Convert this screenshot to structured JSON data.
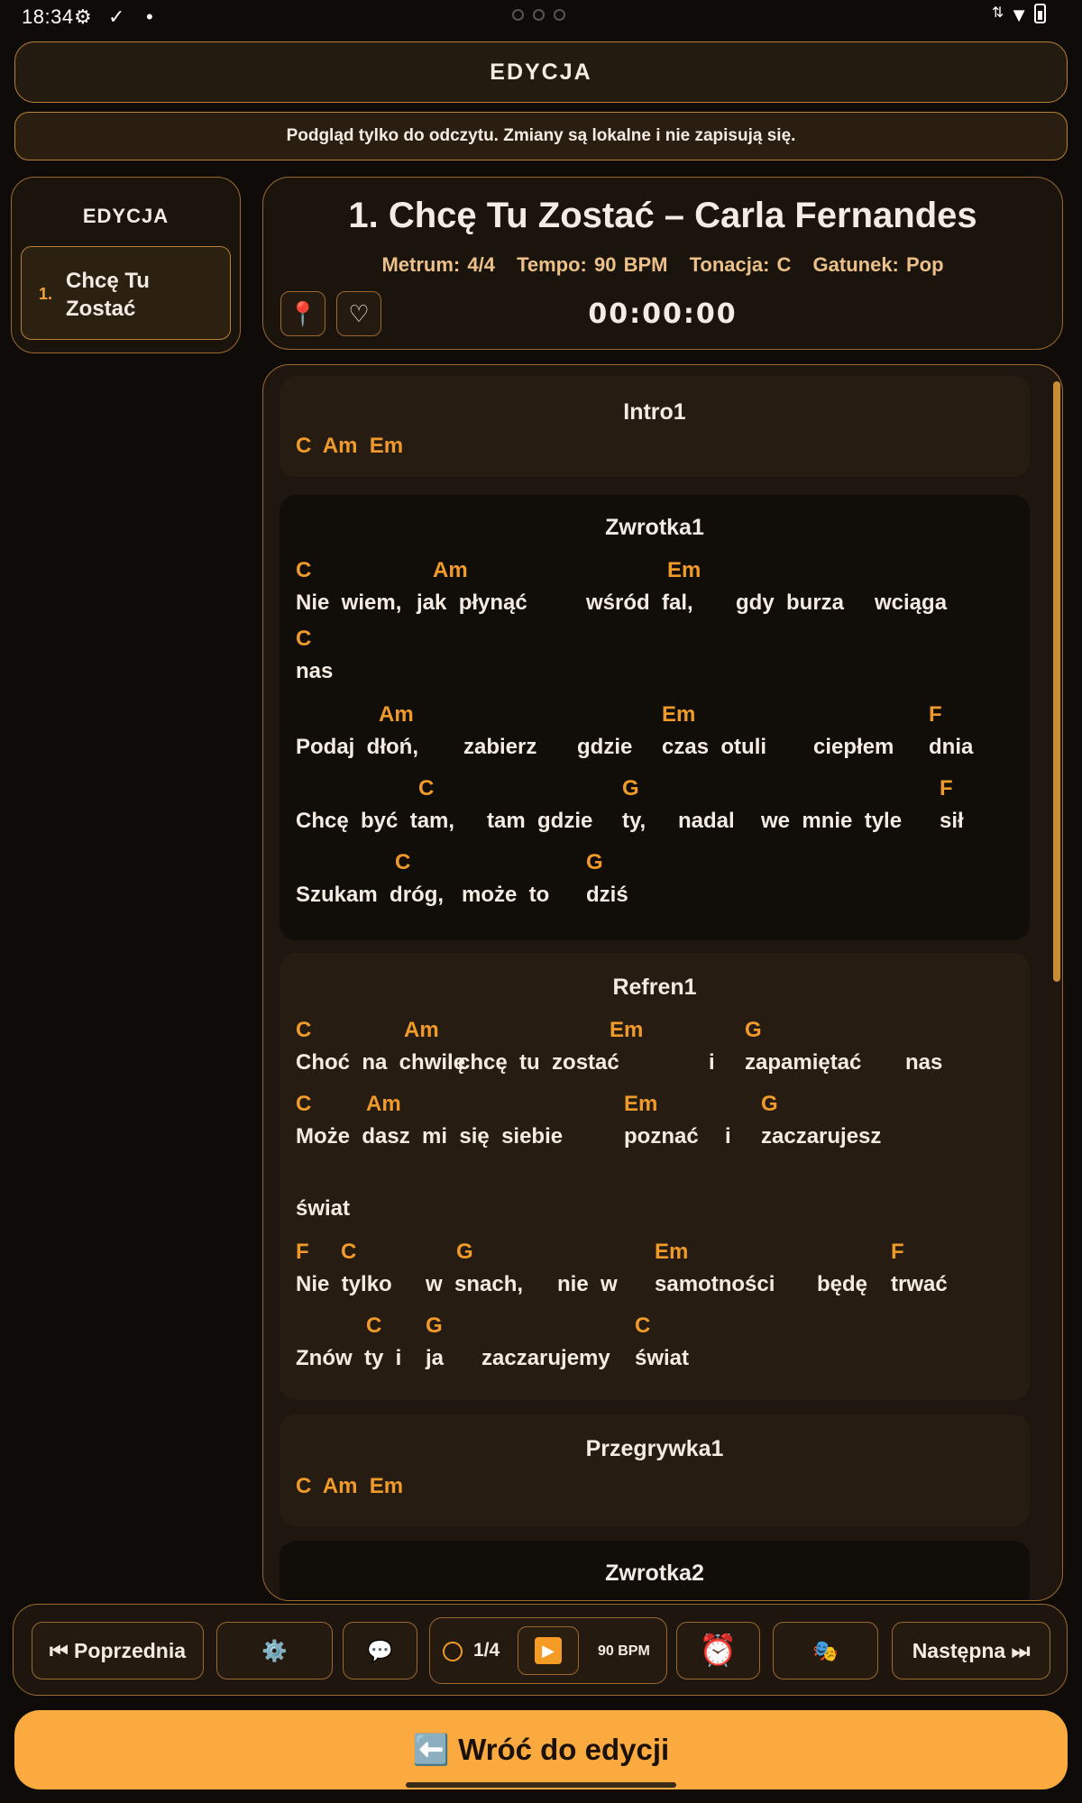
{
  "status_bar": {
    "time": "18:34",
    "icons": [
      "gear-icon",
      "check-circle-icon",
      "dot-icon",
      "data-arrows-icon",
      "wifi-icon",
      "battery-icon"
    ]
  },
  "header": {
    "title": "EDYCJA",
    "notice": "Podgląd tylko do odczytu. Zmiany są lokalne i nie zapisują się."
  },
  "sidebar": {
    "title": "EDYCJA",
    "items": [
      {
        "number": "1.",
        "name": "Chcę Tu Zostać"
      }
    ]
  },
  "song": {
    "title": "1. Chcę Tu Zostać – Carla Fernandes",
    "meter": "Metrum: 4/4",
    "tempo": "Tempo: 90 BPM",
    "key": "Tonacja: C",
    "genre": "Gatunek: Pop",
    "timer": "00:00:00",
    "pin_icon": "📍",
    "heart_icon": "♡"
  },
  "sections": {
    "intro1": {
      "title": "Intro1",
      "chords": "C  Am  Em"
    },
    "zwrotka1": {
      "title": "Zwrotka1",
      "lines": [
        {
          "chords": [
            "C",
            "Am",
            "Em"
          ],
          "lyrics": [
            "Nie  wiem,",
            "jak  płynąć",
            "wśród  fal,",
            "gdy  burza",
            "wciąga"
          ]
        },
        {
          "chords": [
            "C"
          ],
          "lyrics": [
            "nas"
          ]
        },
        {
          "chords": [
            "Am",
            "Em",
            "F"
          ],
          "lyrics": [
            "Podaj  dłoń,",
            "zabierz",
            "gdzie",
            "czas  otuli",
            "ciepłem",
            "dnia"
          ]
        },
        {
          "chords": [
            "C",
            "G",
            "F"
          ],
          "lyrics": [
            "Chcę  być  tam,",
            "tam  gdzie",
            "ty,",
            "nadal",
            "we  mnie  tyle",
            "sił"
          ]
        },
        {
          "chords": [
            "C",
            "G"
          ],
          "lyrics": [
            "Szukam  dróg,",
            "może  to",
            "dziś"
          ]
        }
      ]
    },
    "refren1": {
      "title": "Refren1",
      "lines": [
        {
          "chords": [
            "C",
            "Am",
            "Em",
            "G"
          ],
          "lyrics": [
            "Choć  na  chwilę",
            "chcę  tu  zostać",
            "i",
            "zapamiętać",
            "nas"
          ]
        },
        {
          "chords": [
            "C",
            "Am",
            "Em",
            "G"
          ],
          "lyrics": [
            "Może  dasz  mi  się  siebie",
            "poznać",
            "i",
            "zaczarujesz"
          ]
        },
        {
          "chords": [],
          "lyrics": [
            "świat"
          ]
        },
        {
          "chords": [
            "F",
            "C",
            "G",
            "Em",
            "F"
          ],
          "lyrics": [
            "Nie  tylko",
            "w  snach,",
            "nie  w",
            "samotności",
            "będę",
            "trwać"
          ]
        },
        {
          "chords": [
            "C",
            "G",
            "C"
          ],
          "lyrics": [
            "Znów  ty  i",
            "ja",
            "zaczarujemy",
            "świat"
          ]
        }
      ]
    },
    "przegrywka1": {
      "title": "Przegrywka1",
      "chords": "C  Am  Em"
    },
    "zwrotka2": {
      "title": "Zwrotka2"
    }
  },
  "toolbar": {
    "prev": "⏮ Poprzednia",
    "settings_icon": "⚙️",
    "chat_icon": "💬",
    "beat": "1/4",
    "bpm": "90 BPM",
    "alarm_icon": "⏰",
    "masks_icon": "🎭",
    "next": "Następna ⏭"
  },
  "back_button": "⬅️ Wróć do edycji",
  "colors": {
    "accent": "#f09a2a",
    "border": "#9a6a30",
    "background": "#0f0b08",
    "back_button": "#fbaa3f"
  }
}
